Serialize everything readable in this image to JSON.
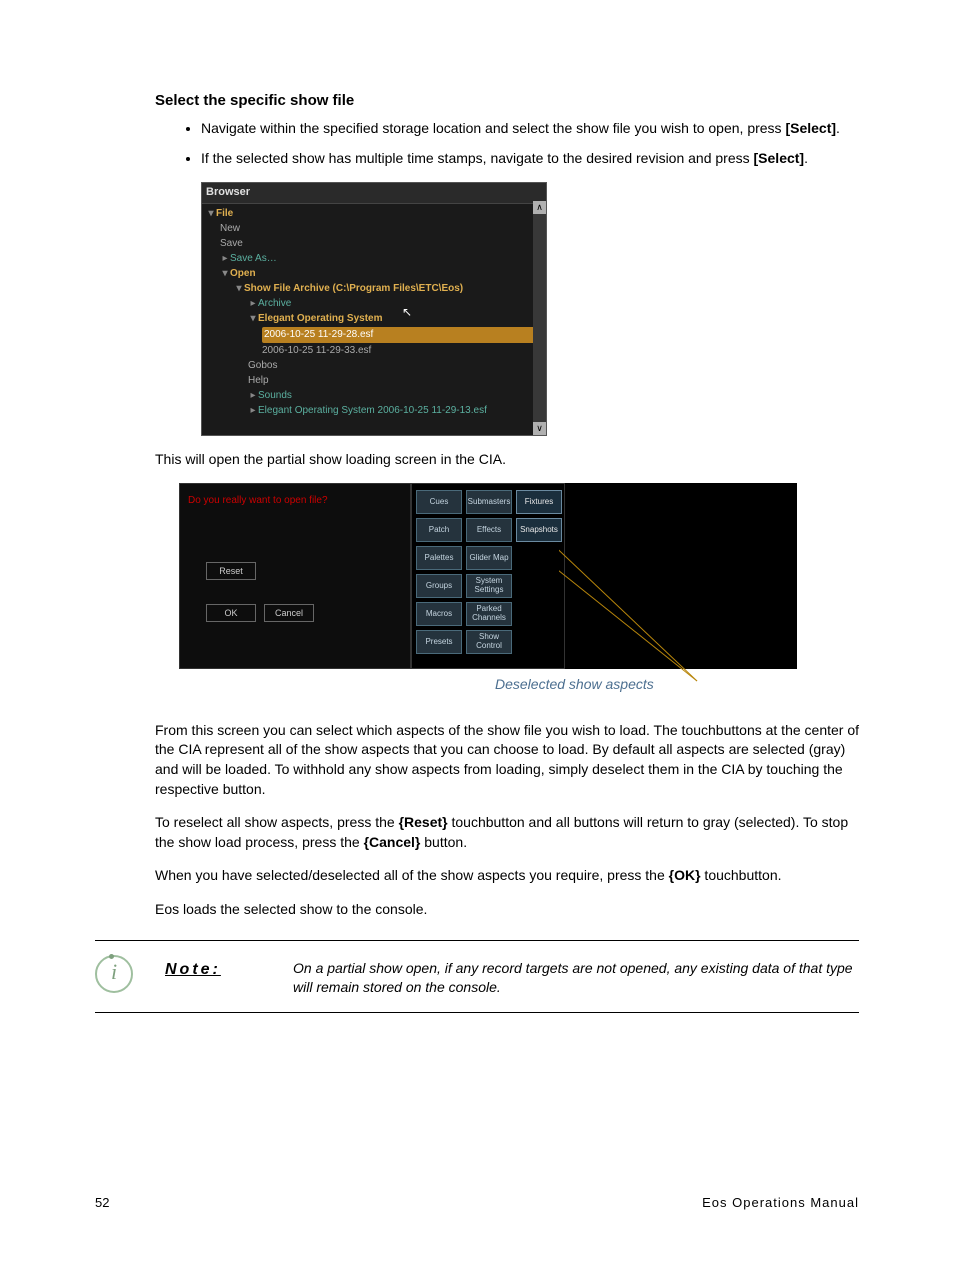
{
  "heading": "Select the specific show file",
  "bullets": [
    {
      "pre": "Navigate within the specified storage location and select the show file you wish to open, press ",
      "bold": "[Select]",
      "post": "."
    },
    {
      "pre": "If the selected show has multiple time stamps, navigate to the desired revision and press ",
      "bold": "[Select]",
      "post": "."
    }
  ],
  "browser": {
    "title": "Browser",
    "file": "File",
    "new": "New",
    "save": "Save",
    "saveAs": "Save As…",
    "open": "Open",
    "archivePath": "Show File Archive (C:\\Program Files\\ETC\\Eos)",
    "archive": "Archive",
    "eos": "Elegant Operating System",
    "row1": "2006-10-25 11-29-28.esf",
    "row2": "2006-10-25 11-29-33.esf",
    "gobos": "Gobos",
    "help": "Help",
    "sounds": "Sounds",
    "lastRow": "Elegant Operating System 2006-10-25 11-29-13.esf",
    "scrollUp": "∧",
    "scrollDown": "∨"
  },
  "afterBrowser": "This will open the partial show loading screen in the CIA.",
  "cia": {
    "prompt": "Do you really want to open file?",
    "reset": "Reset",
    "ok": "OK",
    "cancel": "Cancel",
    "aspects": [
      {
        "label": "Cues",
        "deselected": false
      },
      {
        "label": "Submasters",
        "deselected": false
      },
      {
        "label": "Fixtures",
        "deselected": true
      },
      {
        "label": "Patch",
        "deselected": false
      },
      {
        "label": "Effects",
        "deselected": false
      },
      {
        "label": "Snapshots",
        "deselected": true
      },
      {
        "label": "Palettes",
        "deselected": false
      },
      {
        "label": "Glider Map",
        "deselected": false
      },
      null,
      {
        "label": "Groups",
        "deselected": false
      },
      {
        "label": "System Settings",
        "deselected": false
      },
      null,
      {
        "label": "Macros",
        "deselected": false
      },
      {
        "label": "Parked Channels",
        "deselected": false
      },
      null,
      {
        "label": "Presets",
        "deselected": false
      },
      {
        "label": "Show Control",
        "deselected": false
      }
    ]
  },
  "caption": "Deselected show aspects",
  "para1": "From this screen you can select which aspects of the show file you wish to load. The touchbuttons at the center of the CIA represent all of the show aspects that you can choose to load. By default all aspects are selected (gray) and will be loaded. To withhold any show aspects from loading, simply deselect them in the CIA by touching the respective button.",
  "para2_pre": "To reselect all show aspects, press the ",
  "para2_b1": "{Reset}",
  "para2_mid": " touchbutton and all buttons will return to gray (selected). To stop the show load process, press the ",
  "para2_b2": "{Cancel}",
  "para2_post": " button.",
  "para3_pre": "When you have selected/deselected all of the show aspects you require, press the ",
  "para3_b": "{OK}",
  "para3_post": " touchbutton.",
  "para4": "Eos loads the selected show to the console.",
  "note": {
    "label": "Note:",
    "text": "On a partial show open, if any record targets are not opened, any existing data of that type will remain stored on the console.",
    "icon_glyph": "i"
  },
  "footer": {
    "page": "52",
    "title": "Eos Operations Manual"
  }
}
